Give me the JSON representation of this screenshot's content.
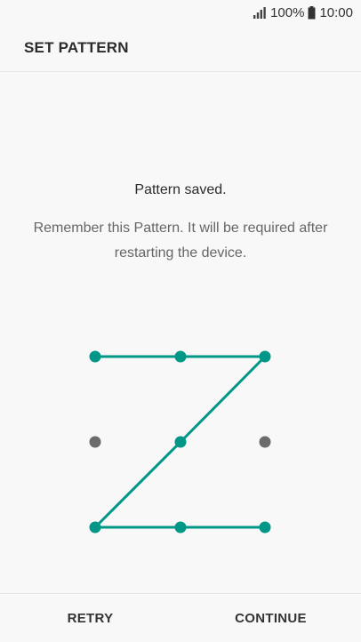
{
  "status_bar": {
    "battery_percent": "100%",
    "time": "10:00"
  },
  "app_bar": {
    "title": "SET PATTERN"
  },
  "message": {
    "title": "Pattern saved.",
    "body": "Remember this Pattern. It will be required after restarting the device."
  },
  "pattern": {
    "active_color": "#009688",
    "inactive_color": "#6b6b6b",
    "grid_size": 3,
    "sequence": [
      0,
      1,
      2,
      4,
      6,
      7,
      8
    ]
  },
  "buttons": {
    "retry": "RETRY",
    "continue": "CONTINUE"
  }
}
